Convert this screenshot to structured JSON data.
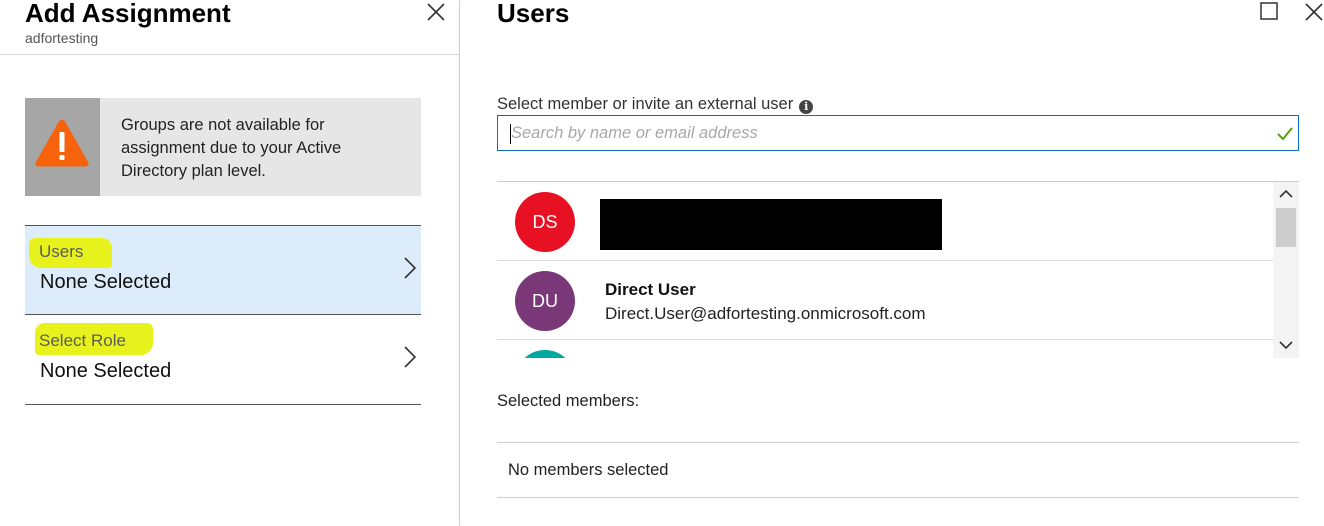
{
  "left_blade": {
    "title": "Add Assignment",
    "subtitle": "adfortesting",
    "close_icon": "close-icon",
    "warning": {
      "icon": "warning-icon",
      "text": "Groups are not available for assignment due to your Active Directory plan level."
    },
    "nav": [
      {
        "label": "Users",
        "value": "None Selected",
        "icon": "chevron-right-icon",
        "selected": true
      },
      {
        "label": "Select Role",
        "value": "None Selected",
        "icon": "chevron-right-icon",
        "selected": false
      }
    ]
  },
  "right_blade": {
    "title": "Users",
    "maximize_icon": "maximize-icon",
    "close_icon": "close-icon",
    "search": {
      "label": "Select member or invite an external user",
      "info_icon": "info-icon",
      "placeholder": "Search by name or email address",
      "value": "",
      "valid_icon": "check-icon"
    },
    "users": [
      {
        "initials": "DS",
        "name": "",
        "email": "",
        "avatar_color": "#e81123",
        "redacted": true
      },
      {
        "initials": "DU",
        "name": "Direct User",
        "email": "Direct.User@adfortesting.onmicrosoft.com",
        "avatar_color": "#7a3879",
        "redacted": false
      },
      {
        "initials": "",
        "name": "",
        "email": "",
        "avatar_color": "#00a99d",
        "redacted": false
      }
    ],
    "selected_members_label": "Selected members:",
    "no_members_text": "No members selected"
  },
  "colors": {
    "accent": "#0a6cc4",
    "selected_nav_bg": "#dcecfa",
    "highlighter": "#e7f21c",
    "warning_orange": "#f7630c",
    "check_green": "#57a300"
  }
}
